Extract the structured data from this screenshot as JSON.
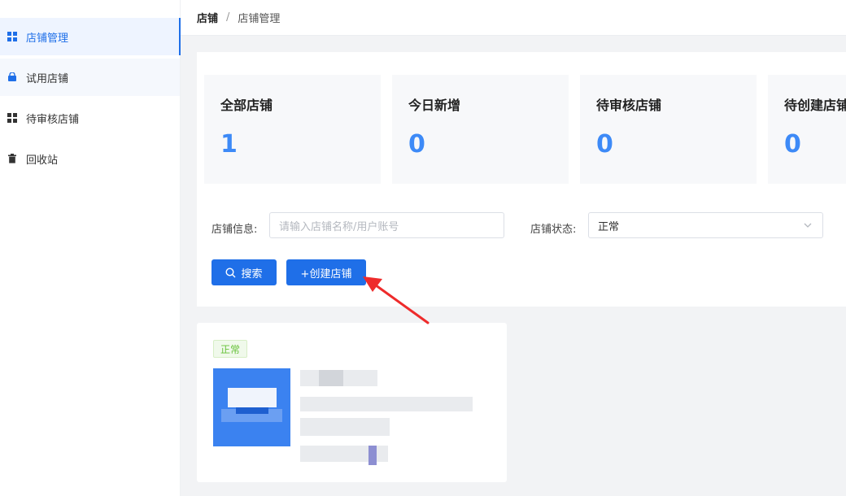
{
  "sidebar": {
    "items": [
      {
        "label": "店铺管理",
        "icon": "grid-icon",
        "active": true
      },
      {
        "label": "试用店铺",
        "icon": "bag-icon",
        "active": false
      },
      {
        "label": "待审核店铺",
        "icon": "grid-icon",
        "active": false
      },
      {
        "label": "回收站",
        "icon": "trash-icon",
        "active": false
      }
    ]
  },
  "breadcrumb": {
    "home": "店铺",
    "separator": "/",
    "current": "店铺管理"
  },
  "stats": [
    {
      "label": "全部店铺",
      "value": "1"
    },
    {
      "label": "今日新增",
      "value": "0"
    },
    {
      "label": "待审核店铺",
      "value": "0"
    },
    {
      "label": "待创建店铺",
      "value": "0"
    }
  ],
  "filters": {
    "info_label": "店铺信息:",
    "info_placeholder": "请输入店铺名称/用户账号",
    "status_label": "店铺状态:",
    "status_value": "正常"
  },
  "buttons": {
    "search": "搜索",
    "create": "+创建店铺"
  },
  "store_card": {
    "status": "正常"
  },
  "colors": {
    "primary": "#1f6fe8",
    "stat_value": "#3d8af7",
    "tag_green": "#67c23a",
    "arrow_red": "#ee2b2b"
  }
}
